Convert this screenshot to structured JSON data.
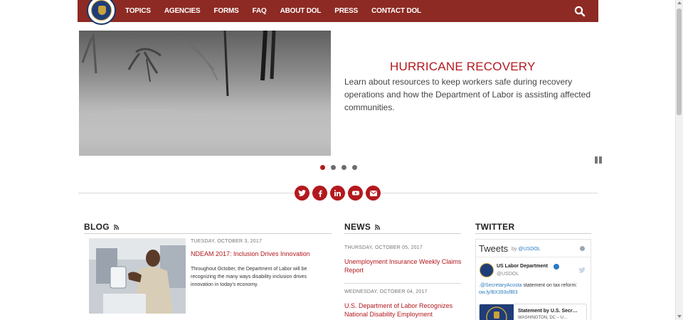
{
  "header": {
    "nav": [
      "TOPICS",
      "AGENCIES",
      "FORMS",
      "FAQ",
      "ABOUT DOL",
      "PRESS",
      "CONTACT DOL"
    ],
    "brand_color": "#8d2a23"
  },
  "hero": {
    "title": "HURRICANE RECOVERY",
    "text": "Learn about resources to keep workers safe during recovery operations and how the Department of Labor is assisting affected communities.",
    "slide_count": 4,
    "active_slide": 1
  },
  "social": [
    "twitter-icon",
    "facebook-icon",
    "linkedin-icon",
    "youtube-icon",
    "email-icon"
  ],
  "blog": {
    "heading": "BLOG",
    "date": "TUESDAY, OCTOBER 3, 2017",
    "title": "NDEAM 2017: Inclusion Drives Innovation",
    "excerpt": "Throughout October, the Department of Labor will be recognizing the many ways disability inclusion drives innovation in today's economy."
  },
  "news": {
    "heading": "NEWS",
    "items": [
      {
        "date": "THURSDAY, OCTOBER 05, 2017",
        "title": "Unemployment Insurance Weekly Claims Report"
      },
      {
        "date": "WEDNESDAY, OCTOBER 04, 2017",
        "title": "U.S. Department of Labor Recognizes National Disability Employment"
      }
    ]
  },
  "twitter": {
    "heading": "TWITTER",
    "widget_title": "Tweets",
    "by": "by",
    "by_handle": "@USDOL",
    "account_name": "US Labor Department",
    "account_handle": "@USDOL",
    "tweet_mention": ".@SecretaryAcosta",
    "tweet_text": " statement on tax reform:",
    "tweet_link": "ow.ly/BX393ofBl3",
    "card_title": "Statement by U.S. Secr…",
    "card_sub": "WASHINGTON, DC – U…"
  },
  "accent": "#b3191e"
}
